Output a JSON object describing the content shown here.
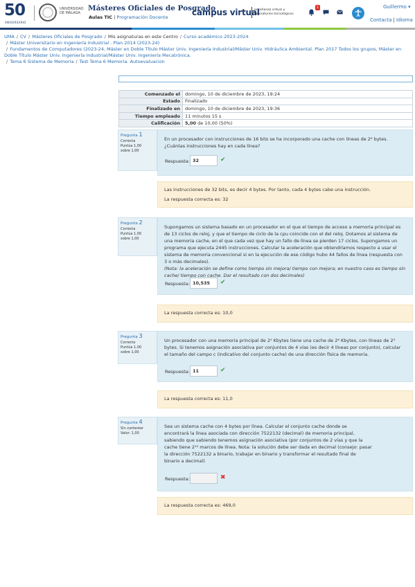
{
  "header": {
    "anniversary_number": "50",
    "anniversary_label": "ANIVERSARIO",
    "university": "UNIVERSIDAD DE MÁLAGA",
    "site_title": "Másteres Oficiales de Posgrado",
    "site_sub_bold": "Aulas TIC",
    "site_sub_sep": "|",
    "site_sub_link": "Programación Docente",
    "campus": "campus virtual",
    "campus_sub": "enseñanza virtual y laboratorios tecnológicos",
    "notification_count": "1",
    "user_name": "Guillermo ▾",
    "contact": "Contacta",
    "language": "Idioma",
    "colors": [
      "#1d3b6e",
      "#2a8bd0",
      "#6fc1e8",
      "#8cc63f",
      "#b0b0b0"
    ]
  },
  "breadcrumb": {
    "line1": [
      "UMA",
      "CV",
      "Másteres Oficiales de Posgrado",
      "Mis asignaturas en este Centro",
      "Curso académico 2023-2024"
    ],
    "line2": "Máster Universitario en Ingeniería Industrial . Plan 2014 (2023-24)",
    "line3": "Fundamentos de Computadores (2023-24, Máster en Doble Título Máster Univ. Ingeniería Industrial/Máster Univ. Hidráulica Ambiental. Plan 2017 Todos los grupos, Máster en Doble Título Máster Univ. Ingeniería Industrial/Máster Univ. Ingeniería Mecatrónica.",
    "line4a": "Tema 6 Sistema de Memoria",
    "line4b": "Test Tema 6 Memoria. Autoevaluacion"
  },
  "summary": [
    {
      "label": "Comenzado el",
      "value": "domingo, 10 de diciembre de 2023, 19:24"
    },
    {
      "label": "Estado",
      "value": "Finalizado"
    },
    {
      "label": "Finalizado en",
      "value": "domingo, 10 de diciembre de 2023, 19:36"
    },
    {
      "label": "Tiempo empleado",
      "value": "11 minutos 15 s"
    },
    {
      "label": "Calificación",
      "value_bold": "5,00",
      "value": "de 10,00 (50%)"
    }
  ],
  "questions": [
    {
      "label": "Pregunta",
      "number": "1",
      "state": "Correcta",
      "points": "Puntúa 1,00",
      "max": "sobre 1,00",
      "text": "En un procesador con instrucciones de 16 bits se ha incorporado una cache con líneas de 2⁸ bytes. ¿Cuántas instrucciones hay en cada línea?",
      "answer_label": "Respuesta:",
      "answer": "32",
      "feedback": [
        "Las instrucciones de 32 bits, es decir 4 bytes. Por tanto, cada 4 bytes cabe una instrucción.",
        "La respuesta correcta es: 32"
      ]
    },
    {
      "label": "Pregunta",
      "number": "2",
      "state": "Correcta",
      "points": "Puntúa 1,00",
      "max": "sobre 1,00",
      "text": "Supongamos un sistema basado en un procesador en el que el tiempo de acceso a memoria principal es de 13 ciclos de reloj, y que el tiempo de ciclo de la cpu coincide con el del reloj. Dotamos al sistema de una memoria cache, en el que cada vez que hay un fallo de línea se pierden 17 ciclos. Supongamos un programa que ejecuta 2445 instrucciones. Calcular la aceleración que obtendríamos respecto a usar el sistema de memoria convencional si en la ejecución de ese código hubo 44 fallos de línea (respuesta con 3 o más decimales).",
      "note": "(Nota: la aceleración se define como tiempo sin mejora/ tiempo con mejora; en nuestro caso es tiempo sin cache/ tiempo con cache. Dar el resultado con dos decimales)",
      "answer_label": "Respuesta:",
      "answer": "10,535",
      "feedback": [
        "La respuesta correcta es: 10,0"
      ]
    },
    {
      "label": "Pregunta",
      "number": "3",
      "state": "Correcta",
      "points": "Puntúa 1,00",
      "max": "sobre 1,00",
      "text": "Un procesador con una memoria principal de 2⁵ Kbytes tiene una cache de 2⁶ Kbytes, con líneas de 2³ bytes. Si tenemos asignación asociativa por conjuntos de 4 vías (es decir 4 líneas por conjunto), calcular el tamaño del campo c (indicativo del conjunto cache) de una dirección física de memoria.",
      "answer_label": "Respuesta:",
      "answer": "11",
      "feedback": [
        "La respuesta correcta es: 11,0"
      ]
    },
    {
      "label": "Pregunta",
      "number": "4",
      "state": "Sin contestar",
      "points": "Valor: 1,00",
      "max": "",
      "text": "Sea un sistema cache con 4 bytes por línea. Calcular el conjunto cache donde se encontrará la línea asociada con dirección 7522132 (decimal) de memoria principal, sabiendo que  sabiendo tenemos asignación asociativa (por conjuntos de 2 vías y que la cache tiene 2¹⁰ marcos de línea.  Nota: la solución debe ser dada en decimal (consejo: pasar la dirección 7522132 a binario, trabajar en binario y transformar el resultado final de binario a decimal)",
      "answer_label": "Respuesta:",
      "answer": "",
      "feedback": [
        "La respuesta correcta es: 469,0"
      ]
    }
  ]
}
